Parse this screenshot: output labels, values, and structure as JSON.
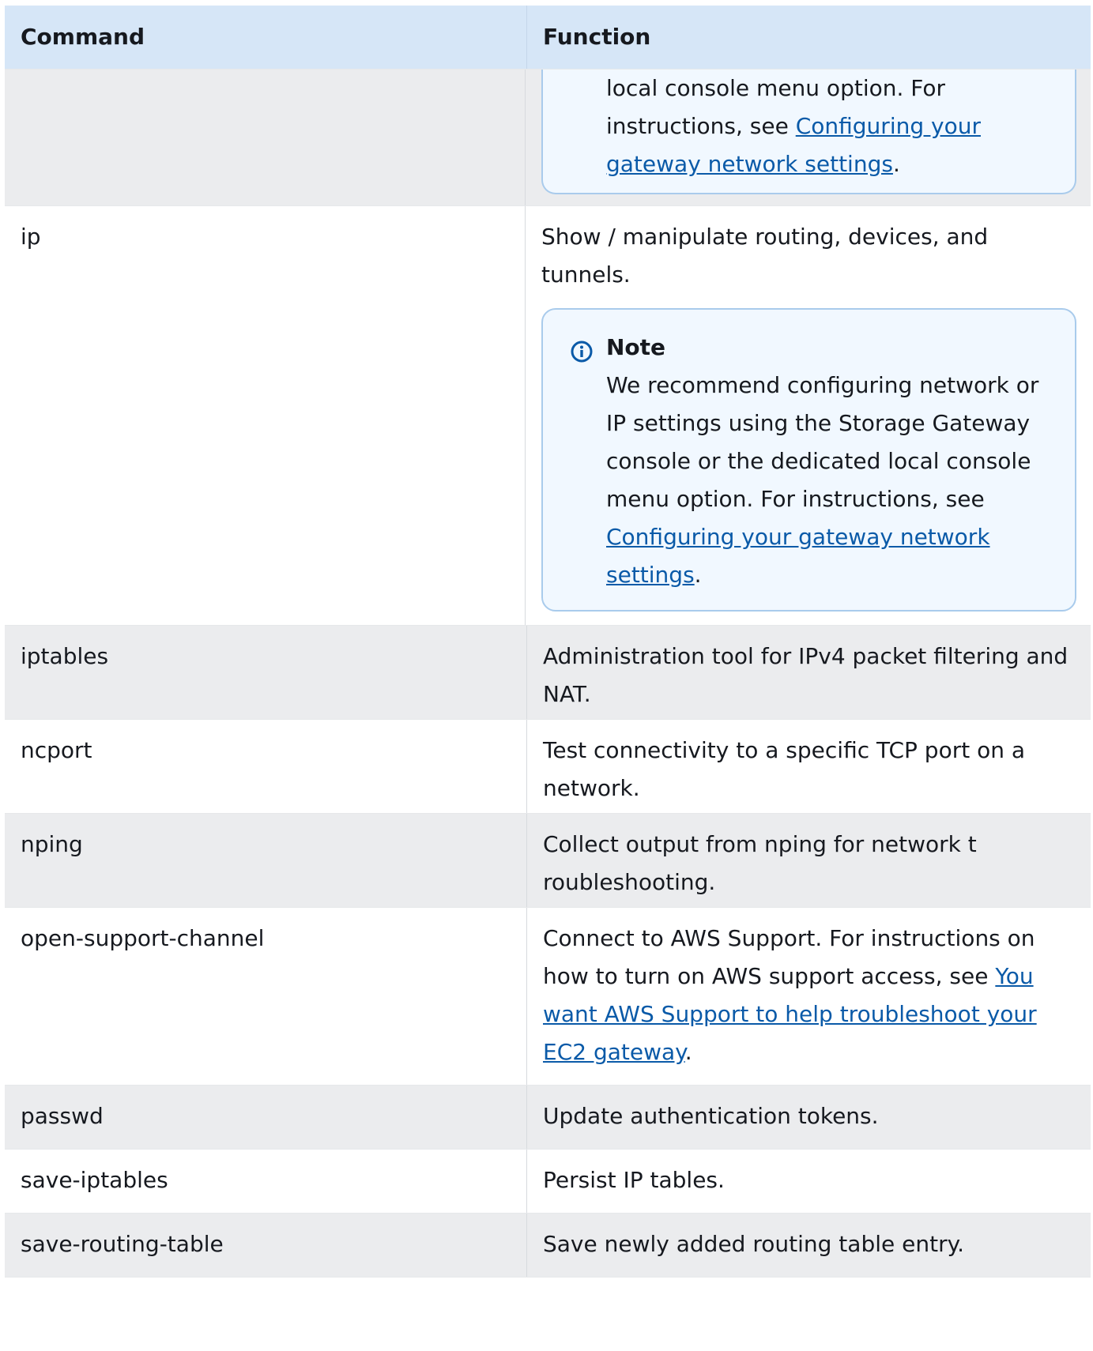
{
  "header": {
    "command": "Command",
    "function": "Function"
  },
  "top_note_continuation": {
    "text_before": "local console menu  option. For instructions, see ",
    "link": "Configuring your gateway network   settings",
    "text_after": "."
  },
  "rows": [
    {
      "command": "ip",
      "function": "Show / manipulate routing, devices, and tunnels.",
      "note": {
        "title": "Note",
        "text_before": "We recommend configuring network or IP settings using  the Storage Gateway console or the dedicated local console menu  option. For instructions, see ",
        "link": "Configuring your gateway network   settings",
        "text_after": "."
      }
    },
    {
      "command": "iptables",
      "function": "Administration tool for IPv4 packet filtering and  NAT."
    },
    {
      "command": "ncport",
      "function": "Test connectivity to a specific TCP port on a  network."
    },
    {
      "command": "nping",
      "function": "Collect output from nping for network  t roubleshooting."
    },
    {
      "command": "open-support-channel",
      "function_before": "Connect to AWS Support. For instructions on how to turn on  AWS support access, see  ",
      "function_link": "You want AWS Support to help troubleshoot your EC2  gateway",
      "function_after": "."
    },
    {
      "command": "passwd",
      "function": "Update authentication tokens."
    },
    {
      "command": "save-iptables",
      "function": "Persist IP tables."
    },
    {
      "command": "save-routing-table",
      "function": "Save newly added routing table entry."
    }
  ],
  "colors": {
    "header_bg": "#d6e6f7",
    "shaded_row": "#ebecee",
    "link": "#0a5aa8",
    "note_border": "#a9cbec",
    "note_bg": "#f1f8ff"
  },
  "icons": {
    "note": "info-circle-icon"
  }
}
